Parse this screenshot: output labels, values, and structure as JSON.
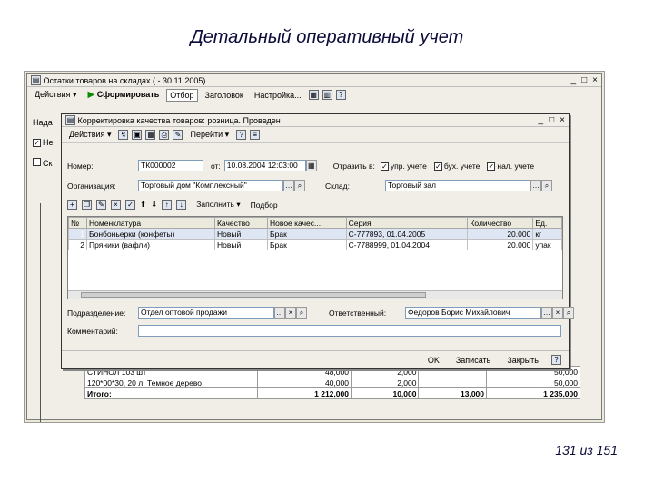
{
  "slide": {
    "title": "Детальный оперативный учет",
    "page": "131 из 151"
  },
  "main_window": {
    "title": "Остатки товаров на складах ( - 30.11.2005)",
    "toolbar": {
      "actions": "Действия",
      "generate": "Сформировать",
      "filter": "Отбор",
      "header": "Заголовок",
      "settings": "Настройка..."
    },
    "labels": {
      "nada": "Нада",
      "ne": "Не",
      "sk": "Ск"
    }
  },
  "bg_rows": [
    {
      "name": "СТИНОЛ 103 шт",
      "c1": "48,000",
      "c2": "2,000",
      "c3": "",
      "c4": "50,000"
    },
    {
      "name": "120*00*30, 20 л, Темное дерево",
      "c1": "40,000",
      "c2": "2,000",
      "c3": "",
      "c4": "50,000"
    },
    {
      "name": "Итого:",
      "c1": "1 212,000",
      "c2": "10,000",
      "c3": "13,000",
      "c4": "1 235,000"
    }
  ],
  "dialog": {
    "title": "Корректировка качества товаров: розница. Проведен",
    "toolbar": {
      "actions": "Действия",
      "goto": "Перейти"
    },
    "number_label": "Номер:",
    "number": "ТК000002",
    "from_label": "от:",
    "date": "10.08.2004 12:03:00",
    "reflect_label": "Отразить в:",
    "upr": "упр. учете",
    "buh": "бух. учете",
    "nal": "нал. учете",
    "org_label": "Организация:",
    "org": "Торговый дом \"Комплексный\"",
    "warehouse_label": "Склад:",
    "warehouse": "Торговый зал",
    "fill": "Заполнить",
    "select": "Подбор",
    "columns": [
      "№",
      "Номенклатура",
      "Качество",
      "Новое качес...",
      "Серия",
      "Количество",
      "Ед."
    ],
    "rows": [
      {
        "n": "1",
        "nom": "Бонбоньерки (конфеты)",
        "q": "Новый",
        "nq": "Брак",
        "ser": "С-777893, 01.04.2005",
        "qty": "20.000",
        "unit": "кг"
      },
      {
        "n": "2",
        "nom": "Пряники (вафли)",
        "q": "Новый",
        "nq": "Брак",
        "ser": "С-7788999, 01.04.2004",
        "qty": "20.000",
        "unit": "упак"
      }
    ],
    "dept_label": "Подразделение:",
    "dept": "Отдел оптовой продажи",
    "resp_label": "Ответственный:",
    "resp": "Федоров Борис Михайлович",
    "comment_label": "Комментарий:",
    "ok": "OK",
    "save": "Записать",
    "close": "Закрыть"
  },
  "colors": {
    "selection": "#0a246a",
    "header": "#ebe9dc",
    "window": "#f0eee6"
  }
}
